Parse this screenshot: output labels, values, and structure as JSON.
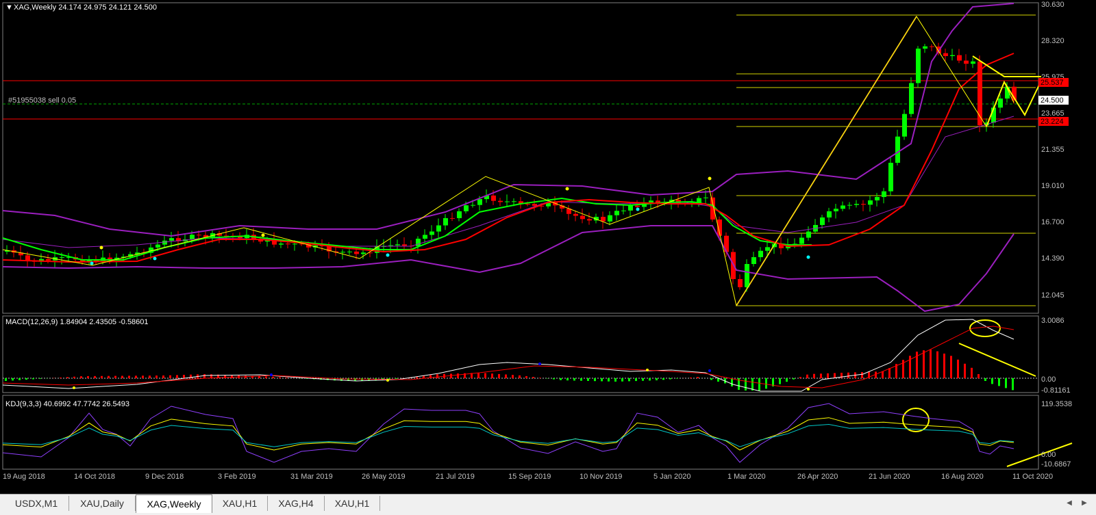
{
  "main": {
    "title_prefix": "▼",
    "title": "XAG,Weekly  24.174 24.975 24.121 24.500",
    "order_label": "#51955038 sell 0.05",
    "price_axis": [
      "30.630",
      "28.320",
      "25.975",
      "23.665",
      "21.355",
      "19.010",
      "16.700",
      "14.390",
      "12.045"
    ],
    "current_price": "24.500",
    "sl_price": "25.537",
    "tp_price": "23.224"
  },
  "macd": {
    "title": "MACD(12,26,9) 1.84904 2.43505 -0.58601",
    "axis": [
      "3.0086",
      "0.00",
      "-0.81161"
    ]
  },
  "kdj": {
    "title": "KDJ(9,3,3) 40.6992 47.7742 26.5493",
    "axis": [
      "119.3538",
      "0.00",
      "-10.6867"
    ]
  },
  "time_axis": [
    "19 Aug 2018",
    "14 Oct 2018",
    "9 Dec 2018",
    "3 Feb 2019",
    "31 Mar 2019",
    "26 May 2019",
    "21 Jul 2019",
    "15 Sep 2019",
    "10 Nov 2019",
    "5 Jan 2020",
    "1 Mar 2020",
    "26 Apr 2020",
    "21 Jun 2020",
    "16 Aug 2020",
    "11 Oct 2020"
  ],
  "tabs": [
    {
      "label": "USDX,M1",
      "active": false
    },
    {
      "label": "XAU,Daily",
      "active": false
    },
    {
      "label": "XAG,Weekly",
      "active": true
    },
    {
      "label": "XAU,H1",
      "active": false
    },
    {
      "label": "XAG,H4",
      "active": false
    },
    {
      "label": "XAU,H1",
      "active": false
    }
  ],
  "colors": {
    "background": "#000000",
    "bull": "#00ff00",
    "bear": "#ff0000",
    "ma_fast": "#00ff00",
    "ma_slow": "#ff0000",
    "bollinger": "#9b1fbf",
    "zigzag": "#ffff00",
    "fibo": "#d4d400",
    "trend": "#c87a20",
    "macd_line": "#ffffff",
    "signal_line": "#ff0000",
    "k_line": "#ffff00",
    "d_line": "#00c8c8",
    "j_line": "#9040ff",
    "axis": "#c0c0c0"
  },
  "icons": {
    "tab_scroll_left": "triangle-left-icon",
    "tab_scroll_right": "triangle-right-icon"
  }
}
